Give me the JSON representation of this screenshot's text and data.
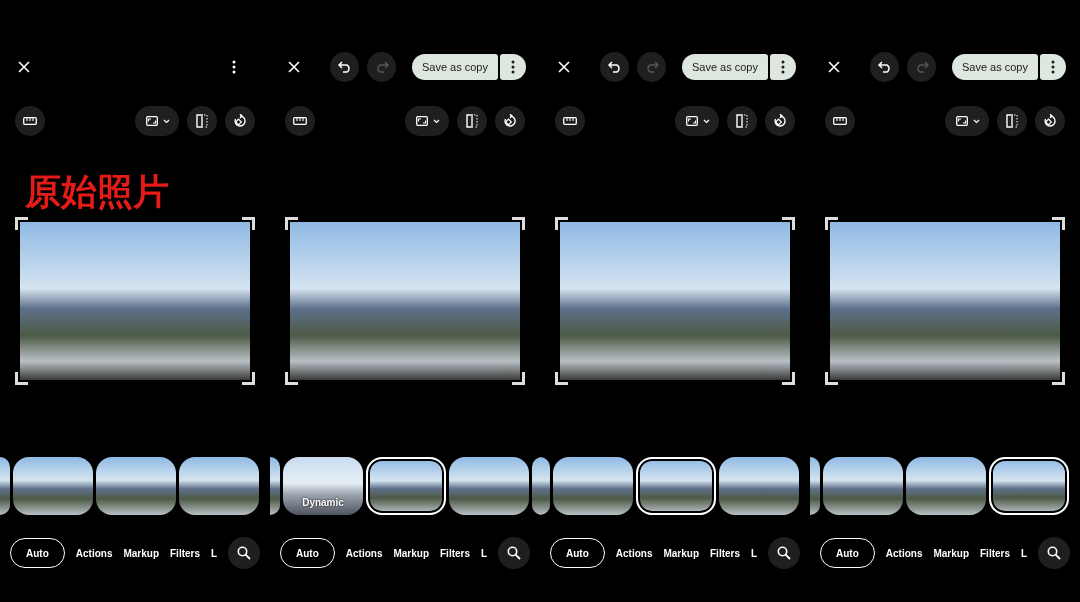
{
  "panels": [
    {
      "caption": "原始照片",
      "thumbnails": [
        {
          "kind": "peek",
          "selected": false
        },
        {
          "kind": "full",
          "selected": false
        },
        {
          "kind": "full",
          "selected": false
        },
        {
          "kind": "full",
          "selected": false
        }
      ],
      "tabs": [
        {
          "label": "Auto",
          "selected": true
        },
        {
          "label": "Actions",
          "selected": false
        },
        {
          "label": "Markup",
          "selected": false
        },
        {
          "label": "Filters",
          "selected": false
        },
        {
          "label": "L",
          "selected": false
        }
      ]
    },
    {
      "undo": {
        "disabled": false
      },
      "redo": {
        "disabled": true
      },
      "save": {
        "label": "Save as copy"
      },
      "thumbnails": [
        {
          "kind": "peek",
          "selected": false
        },
        {
          "kind": "full",
          "selected": false,
          "label": "Dynamic"
        },
        {
          "kind": "full",
          "selected": true
        },
        {
          "kind": "full",
          "selected": false
        },
        {
          "kind": "peek",
          "selected": false
        }
      ],
      "tabs": [
        {
          "label": "Auto",
          "selected": true
        },
        {
          "label": "Actions",
          "selected": false
        },
        {
          "label": "Markup",
          "selected": false
        },
        {
          "label": "Filters",
          "selected": false
        },
        {
          "label": "L",
          "selected": false
        }
      ]
    },
    {
      "undo": {
        "disabled": false
      },
      "redo": {
        "disabled": true
      },
      "save": {
        "label": "Save as copy"
      },
      "thumbnails": [
        {
          "kind": "peek",
          "selected": false
        },
        {
          "kind": "full",
          "selected": false
        },
        {
          "kind": "full",
          "selected": true
        },
        {
          "kind": "full",
          "selected": false
        }
      ],
      "tabs": [
        {
          "label": "Auto",
          "selected": true
        },
        {
          "label": "Actions",
          "selected": false
        },
        {
          "label": "Markup",
          "selected": false
        },
        {
          "label": "Filters",
          "selected": false
        },
        {
          "label": "L",
          "selected": false
        }
      ]
    },
    {
      "undo": {
        "disabled": false
      },
      "redo": {
        "disabled": true
      },
      "save": {
        "label": "Save as copy"
      },
      "thumbnails": [
        {
          "kind": "peek",
          "selected": false
        },
        {
          "kind": "full",
          "selected": false
        },
        {
          "kind": "full",
          "selected": false
        },
        {
          "kind": "full",
          "selected": true
        }
      ],
      "tabs": [
        {
          "label": "Auto",
          "selected": true
        },
        {
          "label": "Actions",
          "selected": false
        },
        {
          "label": "Markup",
          "selected": false
        },
        {
          "label": "Filters",
          "selected": false
        },
        {
          "label": "L",
          "selected": false
        }
      ]
    }
  ]
}
